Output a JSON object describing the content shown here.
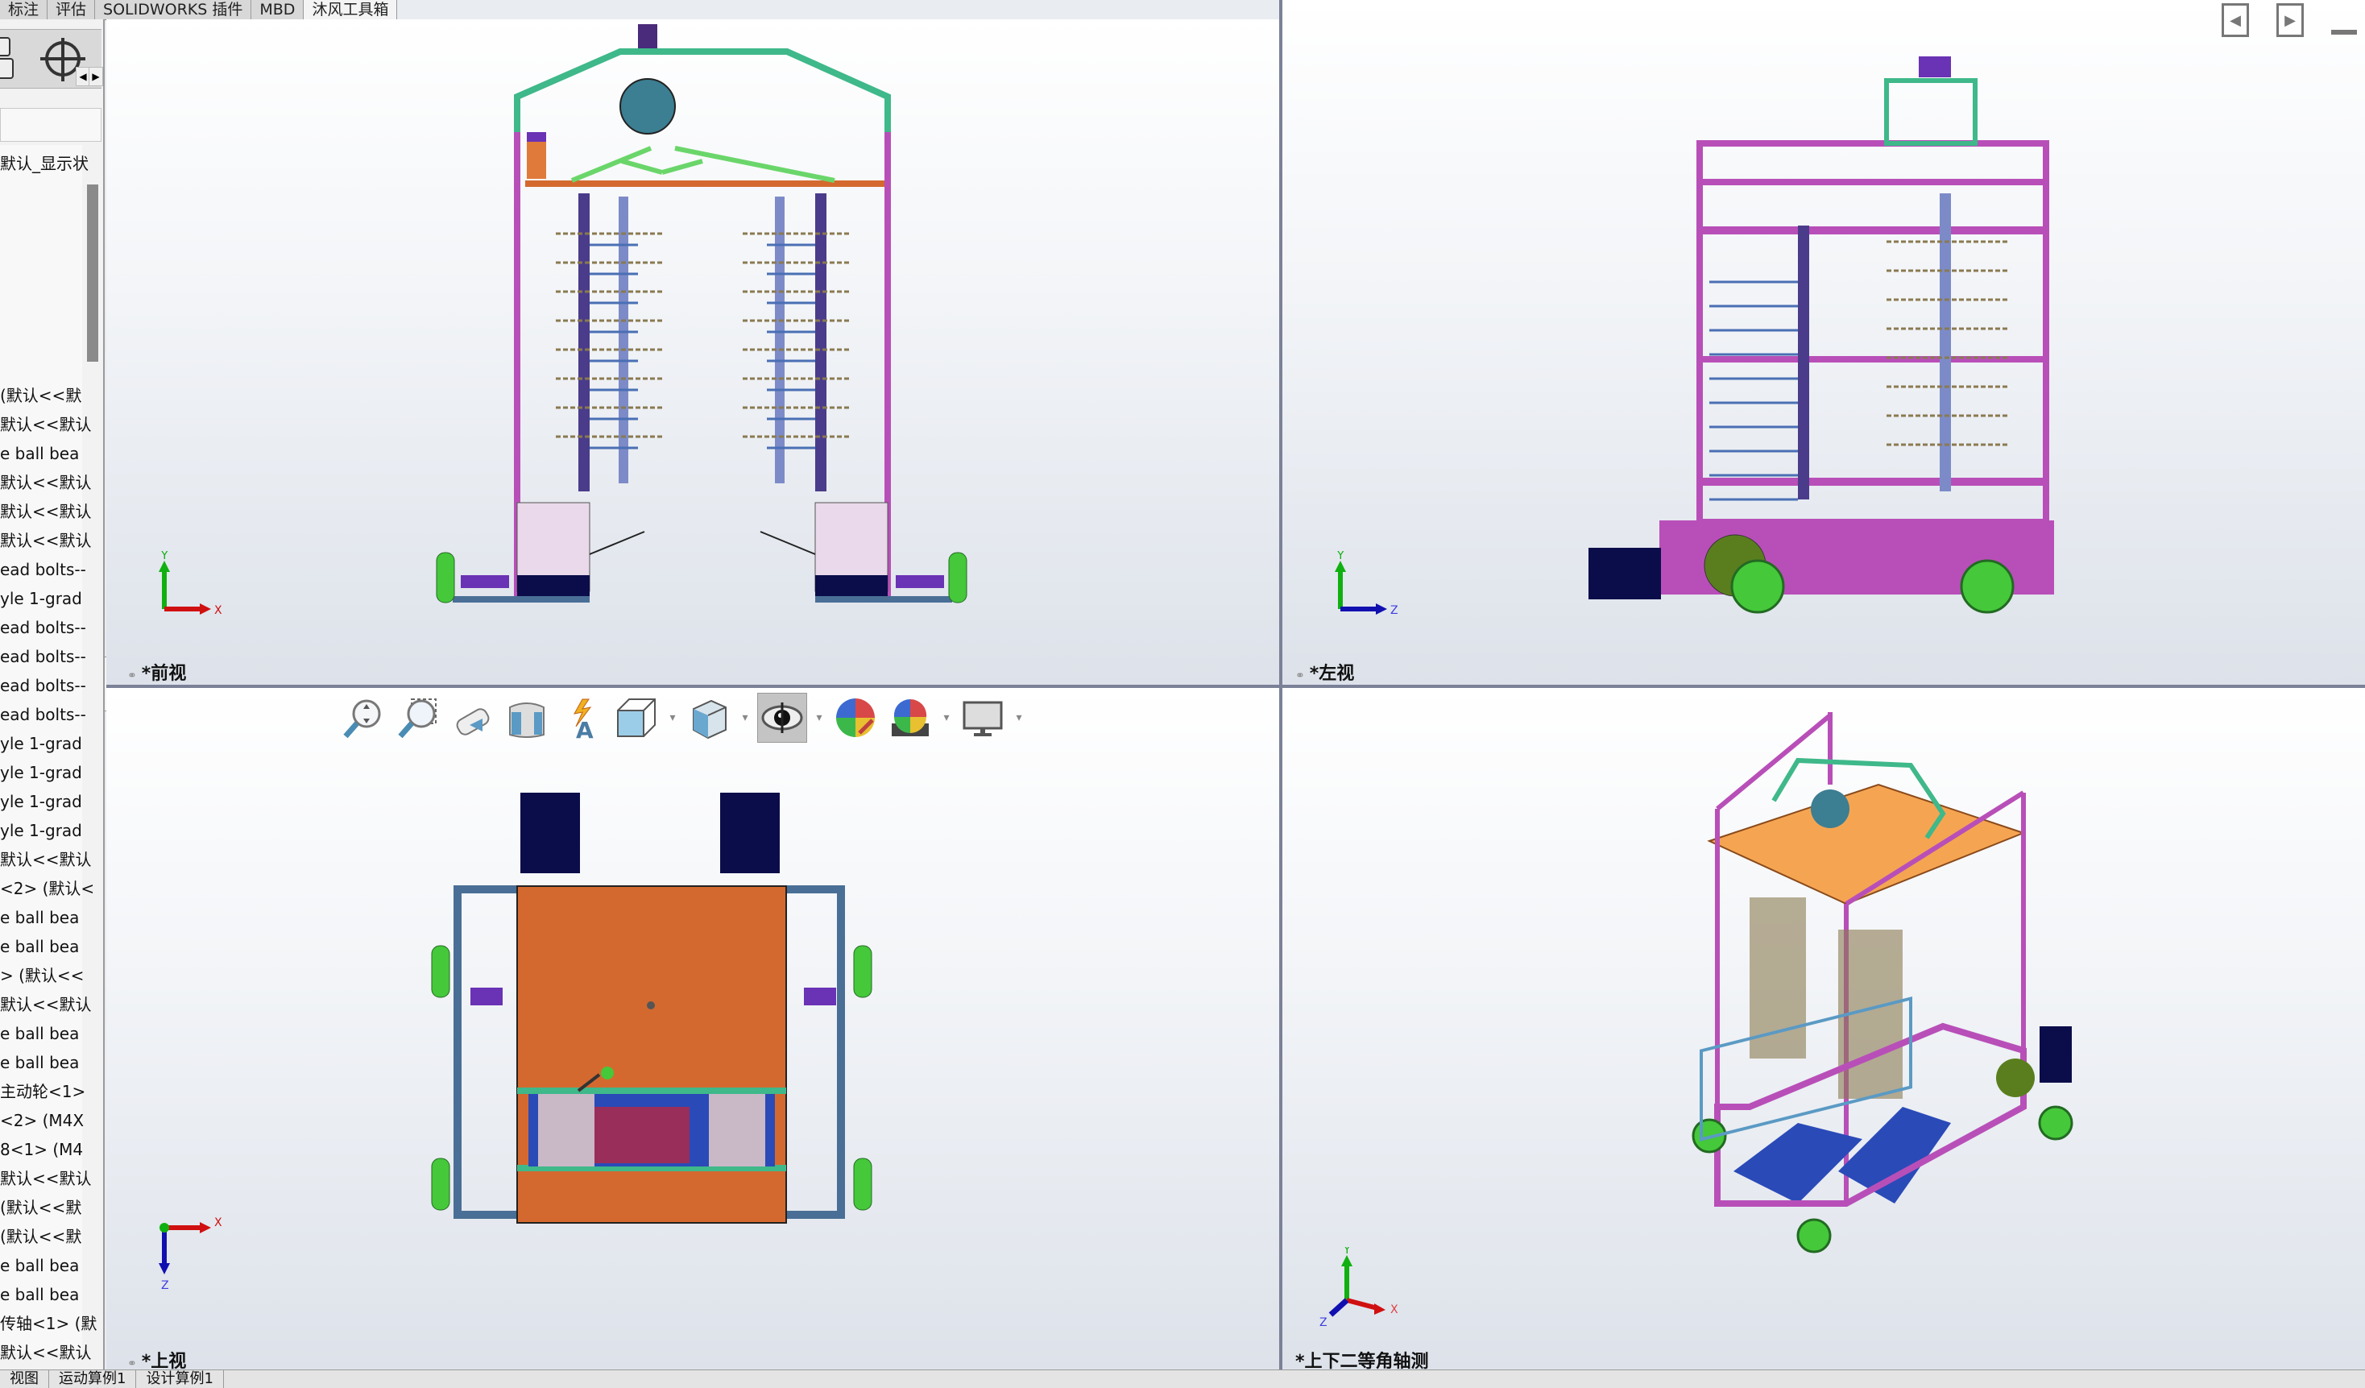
{
  "command_manager_tabs": [
    {
      "label": "标注",
      "active": false
    },
    {
      "label": "评估",
      "active": false
    },
    {
      "label": "SOLIDWORKS 插件",
      "active": false
    },
    {
      "label": "MBD",
      "active": false
    },
    {
      "label": "沐风工具箱",
      "active": true
    }
  ],
  "feature_manager": {
    "toolbar_icons": [
      "configuration-manager-icon",
      "dimxpert-icon"
    ],
    "display_state": "默认_显示状",
    "items": [
      "(默认<<默",
      "默认<<默认",
      "e ball bea",
      "默认<<默认",
      "默认<<默认",
      "默认<<默认",
      "ead bolts--",
      "yle 1-grad",
      "ead bolts--",
      "ead bolts--",
      "ead bolts--",
      "ead bolts--",
      "yle 1-grad",
      "yle 1-grad",
      "yle 1-grad",
      "yle 1-grad",
      "默认<<默认",
      "<2> (默认<",
      "e ball bea",
      "e ball bea",
      "> (默认<<",
      "默认<<默认",
      "e ball bea",
      "e ball bea",
      "主动轮<1>",
      "<2> (M4X",
      "8<1> (M4",
      "默认<<默认",
      "(默认<<默",
      "(默认<<默",
      "e ball bea",
      "e ball bea",
      "传轴<1> (默",
      "默认<<默认"
    ]
  },
  "viewports": {
    "front": {
      "label": "*前视",
      "triad": [
        "Y",
        "X"
      ]
    },
    "left": {
      "label": "*左视",
      "triad": [
        "Y",
        "Z"
      ]
    },
    "top": {
      "label": "*上视",
      "triad": [
        "X",
        "Z"
      ]
    },
    "iso": {
      "label": "*上下二等角轴测",
      "triad": [
        "Y",
        "X",
        "Z"
      ]
    }
  },
  "heads_up_toolbar": [
    {
      "name": "zoom-to-fit-icon"
    },
    {
      "name": "zoom-to-area-icon"
    },
    {
      "name": "previous-view-icon"
    },
    {
      "name": "section-view-icon"
    },
    {
      "name": "dynamic-annotation-views-icon"
    },
    {
      "name": "view-orientation-icon",
      "dropdown": true
    },
    {
      "name": "display-style-icon",
      "dropdown": true
    },
    {
      "name": "hide-show-items-icon",
      "dropdown": true,
      "active": true
    },
    {
      "name": "edit-appearance-icon"
    },
    {
      "name": "apply-scene-icon",
      "dropdown": true
    },
    {
      "name": "view-settings-icon",
      "dropdown": true
    }
  ],
  "bottom_tabs": [
    {
      "label": "视图"
    },
    {
      "label": "运动算例1"
    },
    {
      "label": "设计算例1"
    }
  ],
  "colors": {
    "frame_magenta": "#b84fb8",
    "plate_orange": "#d4692f",
    "plate_light_orange": "#f5a552",
    "wheel_green": "#45c83a",
    "navy_block": "#0b0d4a",
    "steel_blue": "#4a6f96",
    "rail_green": "#3fb88a",
    "shaft_blue": "#7c8bc8",
    "triad_x": "#d01010",
    "triad_y": "#10b010",
    "triad_z": "#1010b0"
  }
}
